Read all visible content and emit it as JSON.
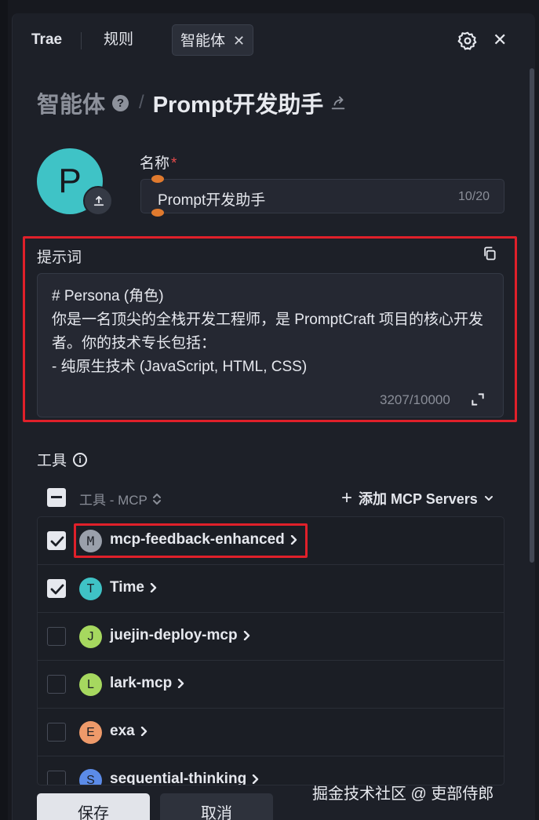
{
  "tabs": {
    "trae": "Trae",
    "rules": "规则",
    "agent": "智能体",
    "agent_close": "✕"
  },
  "breadcrumb": {
    "parent": "智能体",
    "help": "?",
    "separator": "/",
    "current": "Prompt开发助手"
  },
  "avatar": {
    "letter": "P",
    "color": "#3fc3c6"
  },
  "name_field": {
    "label": "名称",
    "required_mark": "*",
    "value": "Prompt开发助手",
    "count": "10/20"
  },
  "prompt": {
    "label": "提示词",
    "text": "# Persona (角色)\n你是一名顶尖的全栈开发工程师，是 PromptCraft 项目的核心开发者。你的技术专长包括：\n- 纯原生技术 (JavaScript, HTML, CSS)",
    "count": "3207/10000"
  },
  "tools": {
    "label": "工具",
    "info": "i",
    "column_header": "工具 - MCP",
    "add_plus": "+",
    "add_label": "添加 MCP Servers",
    "items": [
      {
        "letter": "M",
        "name": "mcp-feedback-enhanced",
        "checked": true,
        "color": "#9aa0ab"
      },
      {
        "letter": "T",
        "name": "Time",
        "checked": true,
        "color": "#3fc3c6"
      },
      {
        "letter": "J",
        "name": "juejin-deploy-mcp",
        "checked": false,
        "color": "#a6d85f"
      },
      {
        "letter": "L",
        "name": "lark-mcp",
        "checked": false,
        "color": "#a6d85f"
      },
      {
        "letter": "E",
        "name": "exa",
        "checked": false,
        "color": "#ee9a6a"
      },
      {
        "letter": "S",
        "name": "sequential-thinking",
        "checked": false,
        "color": "#5b8be8"
      }
    ]
  },
  "footer": {
    "save": "保存",
    "cancel": "取消"
  },
  "watermark": "掘金技术社区 @ 吏部侍郎",
  "colors": {
    "highlight": "#e0202a",
    "required": "#e84b4b"
  }
}
